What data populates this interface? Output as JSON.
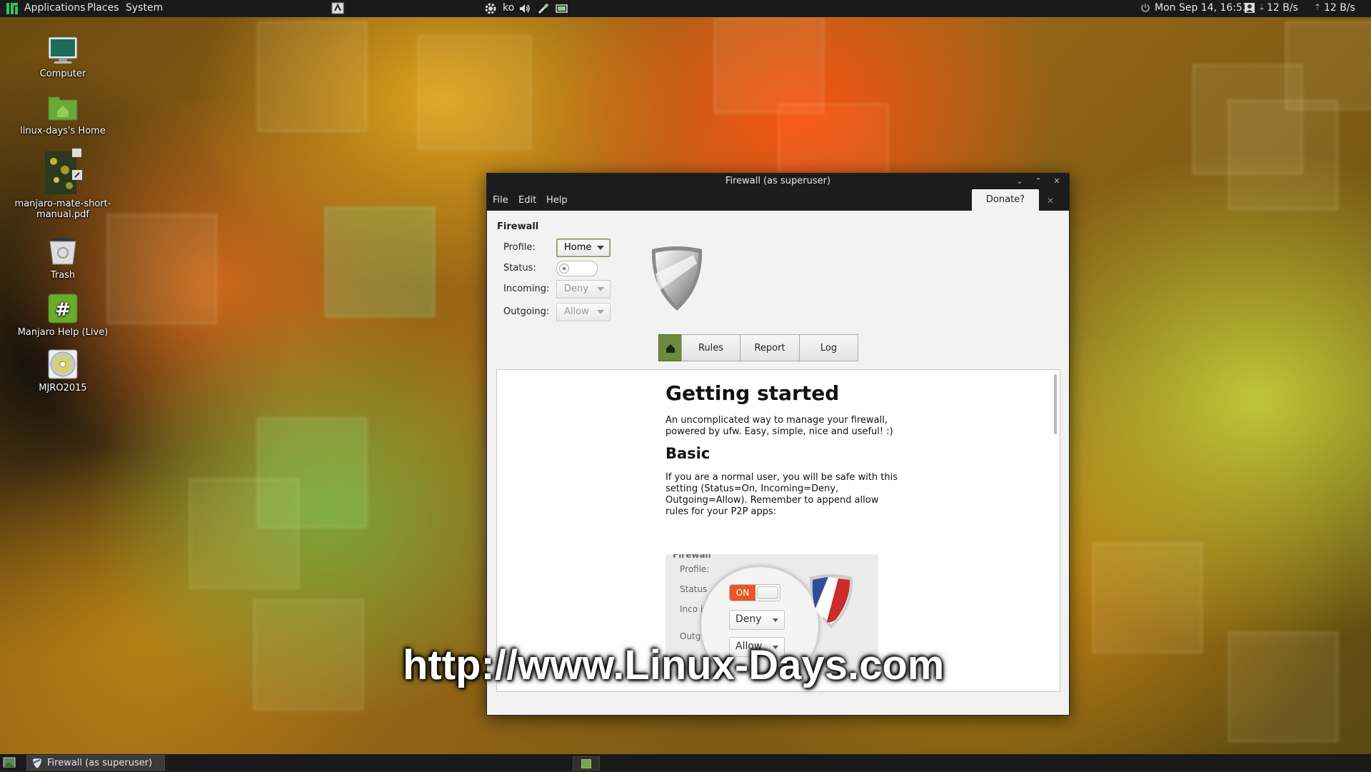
{
  "top_panel": {
    "menus": [
      "Applications",
      "Places",
      "System"
    ],
    "keyboard_layout": "ko",
    "clock": "Mon Sep 14, 16:53",
    "net_down": "12 B/s",
    "net_up": "12 B/s"
  },
  "desktop_icons": [
    {
      "label": "Computer",
      "icon": "computer-icon"
    },
    {
      "label": "linux-days's Home",
      "icon": "home-folder-icon"
    },
    {
      "label": "manjaro-mate-short-manual.pdf",
      "icon": "pdf-file-icon"
    },
    {
      "label": "Trash",
      "icon": "trash-icon"
    },
    {
      "label": "Manjaro Help (Live)",
      "icon": "help-icon"
    },
    {
      "label": "MJRO2015",
      "icon": "dvd-icon"
    }
  ],
  "window": {
    "title": "Firewall (as superuser)",
    "menu": [
      "File",
      "Edit",
      "Help"
    ],
    "donate_label": "Donate?",
    "section_title": "Firewall",
    "form": {
      "profile_label": "Profile:",
      "profile_value": "Home",
      "status_label": "Status:",
      "incoming_label": "Incoming:",
      "incoming_value": "Deny",
      "outgoing_label": "Outgoing:",
      "outgoing_value": "Allow"
    },
    "tabs": [
      "Rules",
      "Report",
      "Log"
    ],
    "content": {
      "heading1": "Getting started",
      "intro": "An uncomplicated way to manage your firewall, powered by ufw. Easy, simple, nice and useful! :)",
      "heading2": "Basic",
      "basic_text": "If you are a normal user, you will be safe with this setting (Status=On, Incoming=Deny, Outgoing=Allow). Remember to append allow rules for your P2P apps:",
      "tutorial": {
        "profile_label": "Profile:",
        "status_label": "Status",
        "incoming_label": "Inco  ing:",
        "outgoing_label": "Outg   ng:",
        "switch_on": "ON",
        "incoming_value": "Deny",
        "outgoing_value": "Allow"
      }
    }
  },
  "watermark": "http://www.Linux-Days.com",
  "taskbar": {
    "task_label": "Firewall (as superuser)"
  },
  "colors": {
    "accent_green": "#6d8b3f",
    "switch_on": "#e8572a",
    "panel": "#1a1a1a"
  }
}
